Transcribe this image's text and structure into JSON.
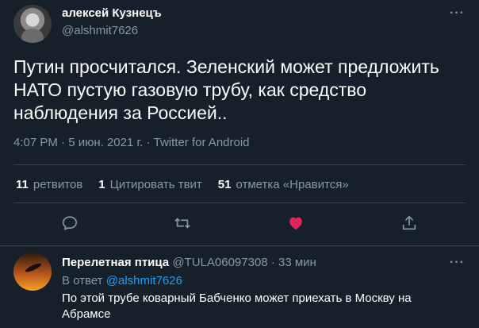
{
  "tweet": {
    "author_name": "алексей Кузнецъ",
    "author_handle": "@alshmit7626",
    "more": "···",
    "text": "Путин просчитался. Зеленский может предложить НАТО пустую газовую трубу, как средство наблюдения за Россией..",
    "meta": "4:07 PM · 5 июн. 2021 г. · Twitter for Android",
    "retweets_count": "11",
    "retweets_label": "ретвитов",
    "quotes_count": "1",
    "quotes_label": "Цитировать твит",
    "likes_count": "51",
    "likes_label": "отметка «Нравится»",
    "like_color": "#e0245e"
  },
  "reply": {
    "author_name": "Перелетная птица",
    "author_handle": "@TULA06097308",
    "separator": "·",
    "time": "33 мин",
    "more": "···",
    "reply_to_label": "В ответ",
    "reply_to_handle": "@alshmit7626",
    "text": "По этой трубе коварный Бабченко может приехать в Москву на Абрамсе"
  },
  "icons": {
    "reply": "comment-icon",
    "retweet": "retweet-icon",
    "like": "heart-icon",
    "share": "share-icon"
  }
}
